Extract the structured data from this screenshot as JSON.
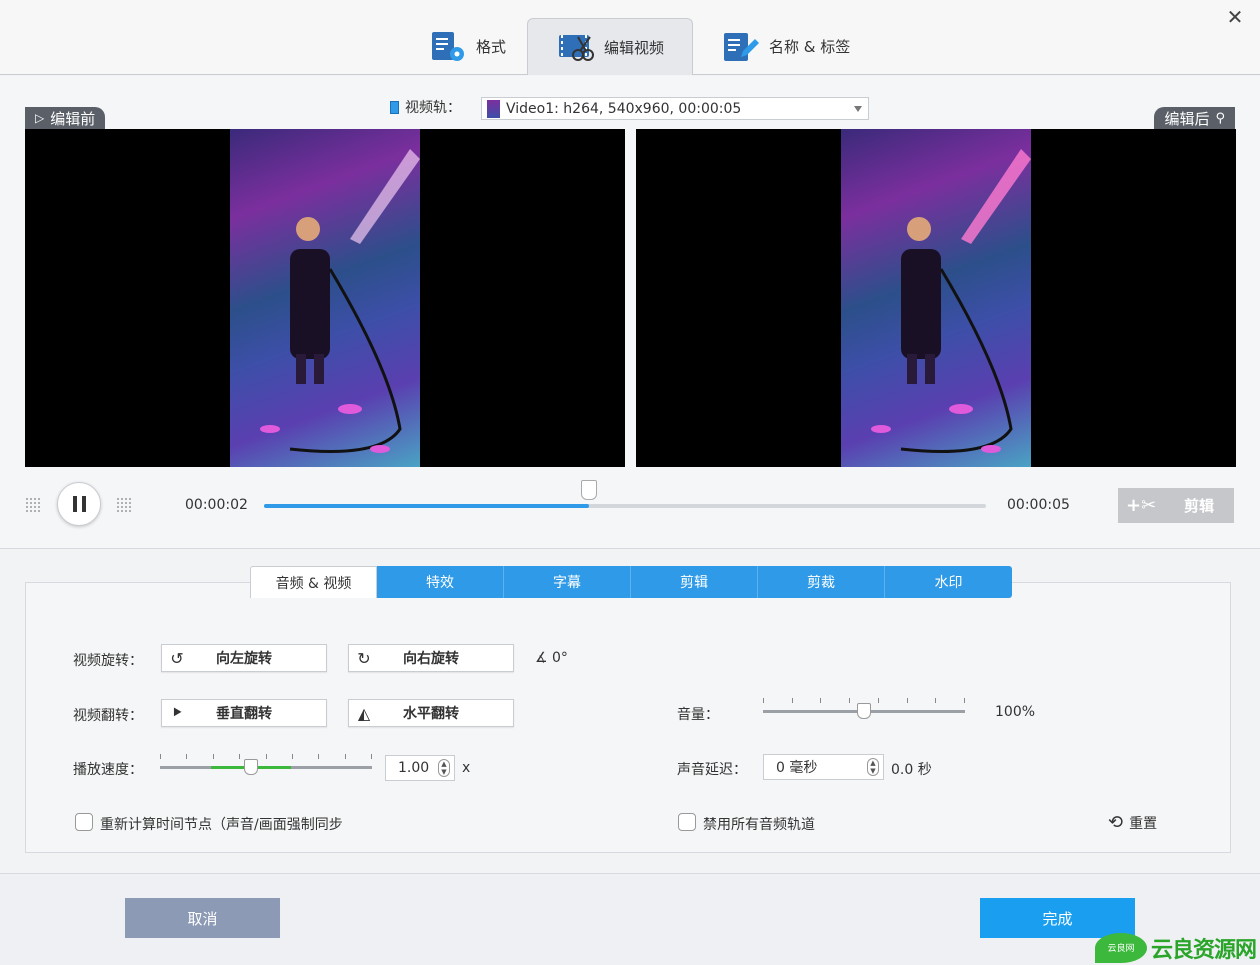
{
  "top_tabs": [
    {
      "label": "格式",
      "icon": "format-settings-icon"
    },
    {
      "label": "编辑视频",
      "icon": "edit-video-icon"
    },
    {
      "label": "名称 & 标签",
      "icon": "name-tag-icon"
    }
  ],
  "close_glyph": "✕",
  "preview": {
    "before_label": "编辑前",
    "after_label": "编辑后",
    "track_label": "视频轨：",
    "track_value": "Video1: h264, 540x960, 00:00:05"
  },
  "playback": {
    "current_time": "00:00:02",
    "total_time": "00:00:05",
    "progress_fraction": 0.45,
    "clip_label": "剪辑"
  },
  "sub_tabs": [
    "音频 & 视频",
    "特效",
    "字幕",
    "剪辑",
    "剪裁",
    "水印"
  ],
  "settings": {
    "rotate_label": "视频旋转：",
    "rotate_left": "向左旋转",
    "rotate_right": "向右旋转",
    "angle": "0°",
    "flip_label": "视频翻转：",
    "flip_vertical": "垂直翻转",
    "flip_horizontal": "水平翻转",
    "speed_label": "播放速度：",
    "speed_value": "1.00",
    "speed_unit": "x",
    "speed_fraction": 0.43,
    "volume_label": "音量：",
    "volume_value": "100%",
    "volume_fraction": 0.5,
    "delay_label": "声音延迟：",
    "delay_value": "0 毫秒",
    "delay_seconds": "0.0 秒",
    "recalc_label": "重新计算时间节点（声音/画面强制同步",
    "disable_audio_label": "禁用所有音频轨道",
    "reset_label": "重置"
  },
  "footer": {
    "cancel": "取消",
    "done": "完成"
  },
  "watermark": {
    "text": "云良资源网",
    "small": "云良网"
  },
  "colors": {
    "accent": "#2f9be8",
    "done": "#1a9ef0",
    "cancel": "#8d9ab5"
  }
}
